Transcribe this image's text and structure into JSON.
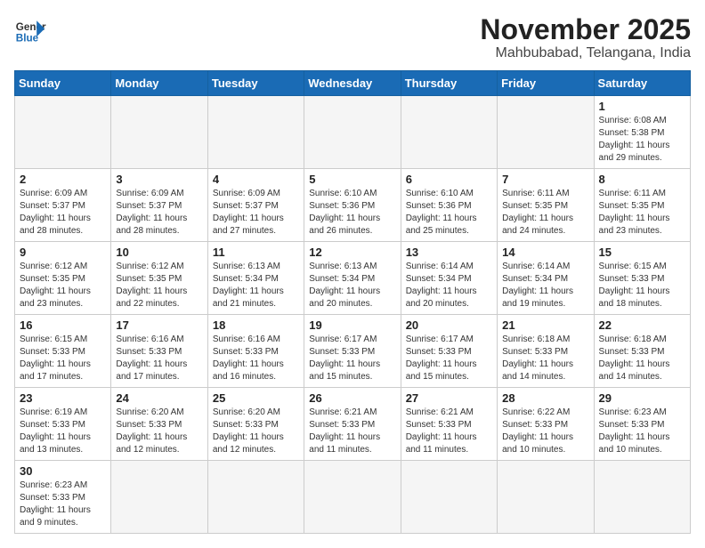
{
  "logo": {
    "text_general": "General",
    "text_blue": "Blue"
  },
  "header": {
    "month_year": "November 2025",
    "location": "Mahbubabad, Telangana, India"
  },
  "weekdays": [
    "Sunday",
    "Monday",
    "Tuesday",
    "Wednesday",
    "Thursday",
    "Friday",
    "Saturday"
  ],
  "days": {
    "d1": {
      "num": "1",
      "sunrise": "6:08 AM",
      "sunset": "5:38 PM",
      "daylight": "11 hours and 29 minutes."
    },
    "d2": {
      "num": "2",
      "sunrise": "6:09 AM",
      "sunset": "5:37 PM",
      "daylight": "11 hours and 28 minutes."
    },
    "d3": {
      "num": "3",
      "sunrise": "6:09 AM",
      "sunset": "5:37 PM",
      "daylight": "11 hours and 28 minutes."
    },
    "d4": {
      "num": "4",
      "sunrise": "6:09 AM",
      "sunset": "5:37 PM",
      "daylight": "11 hours and 27 minutes."
    },
    "d5": {
      "num": "5",
      "sunrise": "6:10 AM",
      "sunset": "5:36 PM",
      "daylight": "11 hours and 26 minutes."
    },
    "d6": {
      "num": "6",
      "sunrise": "6:10 AM",
      "sunset": "5:36 PM",
      "daylight": "11 hours and 25 minutes."
    },
    "d7": {
      "num": "7",
      "sunrise": "6:11 AM",
      "sunset": "5:35 PM",
      "daylight": "11 hours and 24 minutes."
    },
    "d8": {
      "num": "8",
      "sunrise": "6:11 AM",
      "sunset": "5:35 PM",
      "daylight": "11 hours and 23 minutes."
    },
    "d9": {
      "num": "9",
      "sunrise": "6:12 AM",
      "sunset": "5:35 PM",
      "daylight": "11 hours and 23 minutes."
    },
    "d10": {
      "num": "10",
      "sunrise": "6:12 AM",
      "sunset": "5:35 PM",
      "daylight": "11 hours and 22 minutes."
    },
    "d11": {
      "num": "11",
      "sunrise": "6:13 AM",
      "sunset": "5:34 PM",
      "daylight": "11 hours and 21 minutes."
    },
    "d12": {
      "num": "12",
      "sunrise": "6:13 AM",
      "sunset": "5:34 PM",
      "daylight": "11 hours and 20 minutes."
    },
    "d13": {
      "num": "13",
      "sunrise": "6:14 AM",
      "sunset": "5:34 PM",
      "daylight": "11 hours and 20 minutes."
    },
    "d14": {
      "num": "14",
      "sunrise": "6:14 AM",
      "sunset": "5:34 PM",
      "daylight": "11 hours and 19 minutes."
    },
    "d15": {
      "num": "15",
      "sunrise": "6:15 AM",
      "sunset": "5:33 PM",
      "daylight": "11 hours and 18 minutes."
    },
    "d16": {
      "num": "16",
      "sunrise": "6:15 AM",
      "sunset": "5:33 PM",
      "daylight": "11 hours and 17 minutes."
    },
    "d17": {
      "num": "17",
      "sunrise": "6:16 AM",
      "sunset": "5:33 PM",
      "daylight": "11 hours and 17 minutes."
    },
    "d18": {
      "num": "18",
      "sunrise": "6:16 AM",
      "sunset": "5:33 PM",
      "daylight": "11 hours and 16 minutes."
    },
    "d19": {
      "num": "19",
      "sunrise": "6:17 AM",
      "sunset": "5:33 PM",
      "daylight": "11 hours and 15 minutes."
    },
    "d20": {
      "num": "20",
      "sunrise": "6:17 AM",
      "sunset": "5:33 PM",
      "daylight": "11 hours and 15 minutes."
    },
    "d21": {
      "num": "21",
      "sunrise": "6:18 AM",
      "sunset": "5:33 PM",
      "daylight": "11 hours and 14 minutes."
    },
    "d22": {
      "num": "22",
      "sunrise": "6:18 AM",
      "sunset": "5:33 PM",
      "daylight": "11 hours and 14 minutes."
    },
    "d23": {
      "num": "23",
      "sunrise": "6:19 AM",
      "sunset": "5:33 PM",
      "daylight": "11 hours and 13 minutes."
    },
    "d24": {
      "num": "24",
      "sunrise": "6:20 AM",
      "sunset": "5:33 PM",
      "daylight": "11 hours and 12 minutes."
    },
    "d25": {
      "num": "25",
      "sunrise": "6:20 AM",
      "sunset": "5:33 PM",
      "daylight": "11 hours and 12 minutes."
    },
    "d26": {
      "num": "26",
      "sunrise": "6:21 AM",
      "sunset": "5:33 PM",
      "daylight": "11 hours and 11 minutes."
    },
    "d27": {
      "num": "27",
      "sunrise": "6:21 AM",
      "sunset": "5:33 PM",
      "daylight": "11 hours and 11 minutes."
    },
    "d28": {
      "num": "28",
      "sunrise": "6:22 AM",
      "sunset": "5:33 PM",
      "daylight": "11 hours and 10 minutes."
    },
    "d29": {
      "num": "29",
      "sunrise": "6:23 AM",
      "sunset": "5:33 PM",
      "daylight": "11 hours and 10 minutes."
    },
    "d30": {
      "num": "30",
      "sunrise": "6:23 AM",
      "sunset": "5:33 PM",
      "daylight": "11 hours and 9 minutes."
    }
  },
  "labels": {
    "sunrise": "Sunrise:",
    "sunset": "Sunset:",
    "daylight": "Daylight:"
  }
}
